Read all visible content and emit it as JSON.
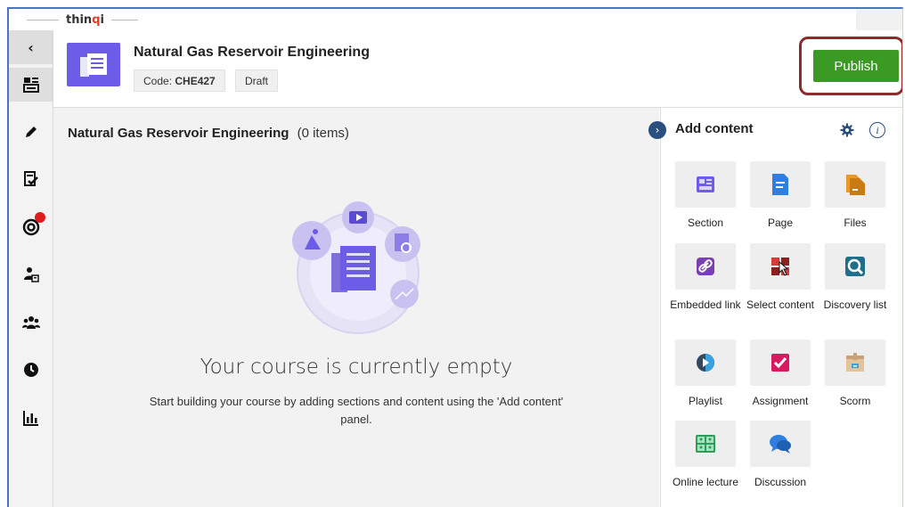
{
  "brand": {
    "logo_text": "thinqi"
  },
  "nav": {
    "items": [
      {
        "name": "collapse",
        "icon": "chevron-left-icon"
      },
      {
        "name": "content",
        "icon": "content-layout-icon"
      },
      {
        "name": "edit",
        "icon": "pencil-icon"
      },
      {
        "name": "assessment",
        "icon": "checklist-icon"
      },
      {
        "name": "goals",
        "icon": "target-icon"
      },
      {
        "name": "learners",
        "icon": "user-badge-icon"
      },
      {
        "name": "groups",
        "icon": "group-icon"
      },
      {
        "name": "history",
        "icon": "clock-icon"
      },
      {
        "name": "reports",
        "icon": "bar-chart-icon"
      }
    ]
  },
  "header": {
    "title": "Natural Gas Reservoir Engineering",
    "code_label": "Code:",
    "code_value": "CHE427",
    "status": "Draft",
    "publish_label": "Publish"
  },
  "main": {
    "title": "Natural Gas Reservoir Engineering",
    "count": "(0 items)",
    "empty_title": "Your course is currently empty",
    "empty_text": "Start building your course by adding sections and content using the 'Add content' panel."
  },
  "panel": {
    "title": "Add content",
    "tiles": [
      {
        "label": "Section",
        "icon": "section-icon"
      },
      {
        "label": "Page",
        "icon": "page-icon"
      },
      {
        "label": "Files",
        "icon": "files-icon"
      },
      {
        "label": "Embedded link",
        "icon": "link-icon"
      },
      {
        "label": "Select content",
        "icon": "select-content-icon"
      },
      {
        "label": "Discovery list",
        "icon": "discovery-icon"
      },
      {
        "label": "Playlist",
        "icon": "playlist-icon"
      },
      {
        "label": "Assignment",
        "icon": "assignment-icon"
      },
      {
        "label": "Scorm",
        "icon": "scorm-icon"
      },
      {
        "label": "Online lecture",
        "icon": "online-lecture-icon"
      },
      {
        "label": "Discussion",
        "icon": "discussion-icon"
      }
    ]
  },
  "colors": {
    "publish": "#3a9a24",
    "publish_outline": "#8b2b2b",
    "course_icon": "#6c5ce7",
    "notification": "#e01b1b",
    "panel_accent": "#2a4e7e"
  }
}
